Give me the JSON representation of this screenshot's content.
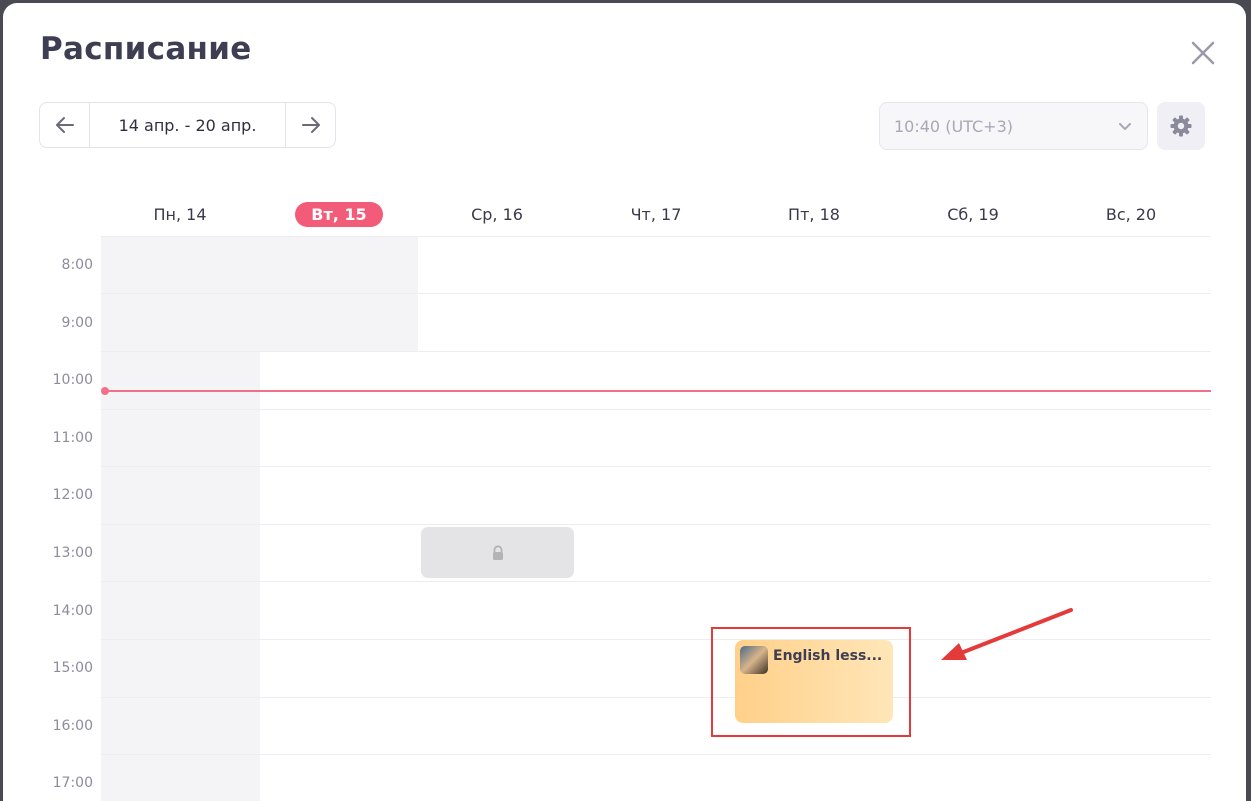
{
  "header": {
    "title": "Расписание"
  },
  "week_nav": {
    "range": "14 апр. - 20 апр."
  },
  "timezone": {
    "selected": "10:40 (UTC+3)"
  },
  "days": [
    {
      "label": "Пн, 14",
      "today": false
    },
    {
      "label": "Вт, 15",
      "today": true
    },
    {
      "label": "Ср, 16",
      "today": false
    },
    {
      "label": "Чт, 17",
      "today": false
    },
    {
      "label": "Пт, 18",
      "today": false
    },
    {
      "label": "Сб, 19",
      "today": false
    },
    {
      "label": "Вс, 20",
      "today": false
    }
  ],
  "hours": [
    "8:00",
    "9:00",
    "10:00",
    "11:00",
    "12:00",
    "13:00",
    "14:00",
    "15:00",
    "16:00",
    "17:00"
  ],
  "events": [
    {
      "title": "English less..."
    }
  ],
  "colors": {
    "accent": "#f25c78",
    "now_line": "#f2708a",
    "event_from": "#ffd089",
    "event_to": "#ffe6b8",
    "annotation": "#e53a3a"
  },
  "icons": {
    "close": "close-icon",
    "prev": "arrow-left-icon",
    "next": "arrow-right-icon",
    "dropdown": "chevron-down-icon",
    "settings": "gear-icon",
    "locked": "lock-icon"
  }
}
